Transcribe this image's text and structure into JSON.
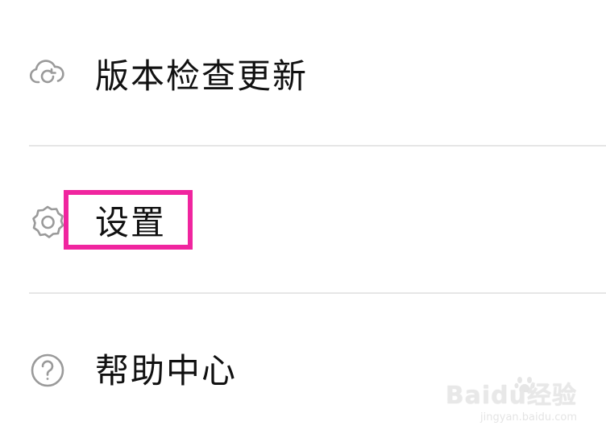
{
  "menu": {
    "items": [
      {
        "label": "版本检查更新",
        "icon": "cloud-sync-icon"
      },
      {
        "label": "设置",
        "icon": "gear-icon"
      },
      {
        "label": "帮助中心",
        "icon": "help-circle-icon"
      }
    ]
  },
  "annotation": {
    "highlight_color": "#f0259f"
  },
  "watermark": {
    "main": "Baidu经验",
    "sub": "jingyan.baidu.com"
  }
}
